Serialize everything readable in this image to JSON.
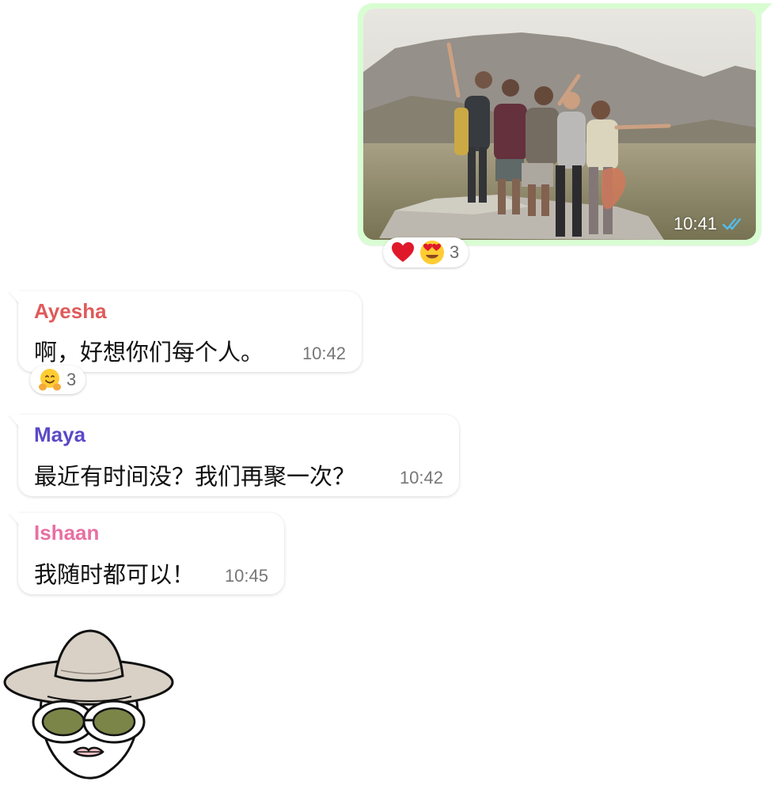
{
  "outgoing_photo": {
    "time": "10:41",
    "status_icon": "double-check-icon",
    "reactions": {
      "emojis": [
        "red-heart-icon",
        "heart-eyes-icon"
      ],
      "count": "3"
    }
  },
  "messages": [
    {
      "sender": "Ayesha",
      "sender_color": "#e05a5a",
      "text": "啊，好想你们每个人。",
      "time": "10:42",
      "reactions": {
        "emojis": [
          "hugging-face-icon"
        ],
        "count": "3"
      }
    },
    {
      "sender": "Maya",
      "sender_color": "#5b49c8",
      "text": "最近有时间没？我们再聚一次？",
      "time": "10:42"
    },
    {
      "sender": "Ishaan",
      "sender_color": "#e86fa3",
      "text": "我随时都可以！",
      "time": "10:45"
    }
  ],
  "colors": {
    "outgoing_bubble": "#d9fdd3",
    "incoming_bubble": "#ffffff",
    "read_ticks": "#53bdeb"
  }
}
